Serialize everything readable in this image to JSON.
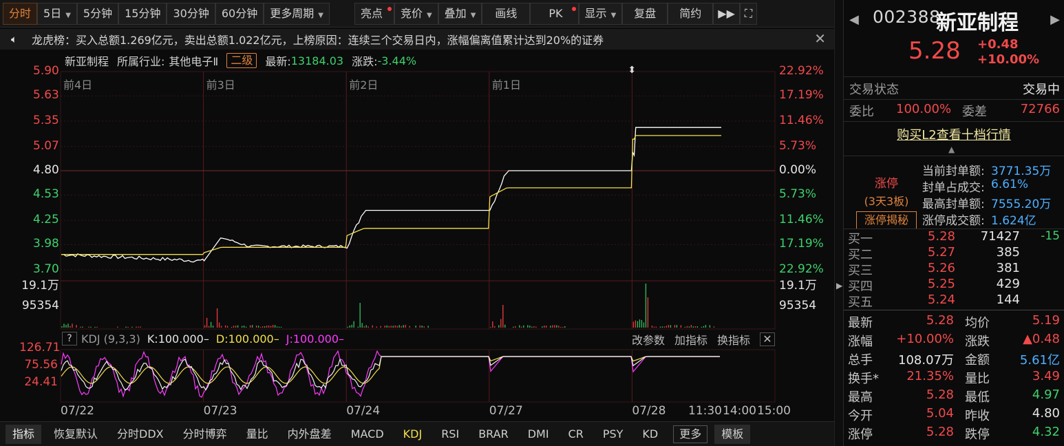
{
  "toolbar": {
    "buttons": [
      {
        "label": "分时"
      },
      {
        "label": "5日"
      },
      {
        "label": "5分钟"
      },
      {
        "label": "15分钟"
      },
      {
        "label": "30分钟"
      },
      {
        "label": "60分钟"
      },
      {
        "label": "更多周期"
      },
      {
        "label": "亮点"
      },
      {
        "label": "竞价"
      },
      {
        "label": "叠加"
      },
      {
        "label": "画线"
      },
      {
        "label": "PK"
      },
      {
        "label": "显示"
      },
      {
        "label": "复盘"
      },
      {
        "label": "简约"
      }
    ]
  },
  "notice": {
    "text": "龙虎榜：买入总额1.269亿元，卖出总额1.022亿元，上榜原因：连续三个交易日内，涨幅偏离值累计达到20%的证券"
  },
  "info": {
    "name": "新亚制程",
    "industry_label": "所属行业:",
    "industry": "其他电子Ⅱ",
    "level": "二级",
    "latest_label": "最新:",
    "latest": "13184.03",
    "change_label": "涨跌:",
    "change": "-3.44%"
  },
  "chart_data": [
    {
      "type": "line",
      "title": "",
      "y_left_ticks": [
        "5.90",
        "5.63",
        "5.35",
        "5.07",
        "4.80",
        "4.53",
        "4.25",
        "3.98",
        "3.70"
      ],
      "y_right_ticks": [
        "22.92%",
        "17.19%",
        "11.46%",
        "5.73%",
        "0.00%",
        "5.73%",
        "11.46%",
        "17.19%",
        "22.92%"
      ],
      "ylim": [
        3.7,
        5.9
      ],
      "prev_close": 4.8,
      "day_labels": [
        "前4日",
        "前3日",
        "前2日",
        "前1日"
      ],
      "x_labels": [
        "07/22",
        "07/23",
        "07/24",
        "07/27",
        "07/28",
        "11:30",
        "14:00",
        "15:00"
      ],
      "series": [
        {
          "name": "price",
          "color": "#ffffff",
          "days": [
            {
              "open": 3.87,
              "close": 3.8,
              "high": 3.9,
              "low": 3.76
            },
            {
              "open": 3.8,
              "close": 3.96,
              "high": 4.06,
              "low": 3.79
            },
            {
              "open": 3.96,
              "close": 4.36,
              "high": 4.36,
              "low": 3.94
            },
            {
              "open": 4.36,
              "close": 4.8,
              "high": 4.8,
              "low": 4.36
            },
            {
              "open": 5.04,
              "close": 5.28,
              "high": 5.28,
              "low": 4.97
            }
          ]
        },
        {
          "name": "avg",
          "color": "#f2e04a",
          "days": [
            3.87,
            3.95,
            4.16,
            4.61,
            5.19
          ]
        }
      ]
    },
    {
      "type": "bar",
      "title": "",
      "y_ticks": [
        "19.1万",
        "95354"
      ],
      "ylim": [
        0,
        191000
      ],
      "note": "intraday volume"
    },
    {
      "type": "line",
      "title": "KDJ (9,3,3)",
      "y_ticks": [
        "126.71",
        "75.56",
        "24.41"
      ],
      "series": [
        {
          "name": "K",
          "value": "100.000",
          "color": "#f0f0f0"
        },
        {
          "name": "D",
          "value": "100.000",
          "color": "#f2e04a"
        },
        {
          "name": "J",
          "value": "100.000",
          "color": "#ff3aff"
        }
      ]
    }
  ],
  "kdj": {
    "help": "?",
    "name": "KDJ (9,3,3)",
    "k": "K:100.000–",
    "d": "D:100.000–",
    "j": "J:100.000–",
    "tools": [
      "改参数",
      "加指标",
      "换指标"
    ]
  },
  "bottom_tabs": [
    "指标",
    "恢复默认",
    "分时DDX",
    "分时博弈",
    "量比",
    "内外盘差",
    "MACD",
    "KDJ",
    "RSI",
    "BRAR",
    "DMI",
    "CR",
    "PSY",
    "KD",
    "更多",
    "模板"
  ],
  "quote": {
    "code": "002388",
    "name": "新亚制程",
    "price": "5.28",
    "change": "+0.48",
    "pct": "+10.00%",
    "status_label": "交易状态",
    "status": "交易中",
    "weibi_label": "委比",
    "weibi": "100.00%",
    "weicha_label": "委差",
    "weicha": "72766",
    "l2_link": "购买L2查看十档行情",
    "limit_label": "涨停",
    "limit_days": "(3天3板)",
    "limit_btn": "涨停揭秘",
    "seal": [
      {
        "label": "当前封单额:",
        "value": "3771.35万"
      },
      {
        "label": "封单占成交:",
        "value": "6.61%"
      },
      {
        "label": "最高封单额:",
        "value": "7555.20万"
      },
      {
        "label": "涨停成交额:",
        "value": "1.624亿"
      }
    ],
    "bids": [
      {
        "label": "买一",
        "price": "5.28",
        "vol": "71427",
        "delta": "-15"
      },
      {
        "label": "买二",
        "price": "5.27",
        "vol": "385",
        "delta": ""
      },
      {
        "label": "买三",
        "price": "5.26",
        "vol": "381",
        "delta": ""
      },
      {
        "label": "买四",
        "price": "5.25",
        "vol": "429",
        "delta": ""
      },
      {
        "label": "买五",
        "price": "5.24",
        "vol": "144",
        "delta": ""
      }
    ],
    "stats": [
      {
        "l1": "最新",
        "v1": "5.28",
        "l2": "均价",
        "v2": "5.19"
      },
      {
        "l1": "涨幅",
        "v1": "+10.00%",
        "l2": "涨跌",
        "v2": "▲0.48"
      },
      {
        "l1": "总手",
        "v1": "108.07万",
        "l2": "金额",
        "v2": "5.61亿"
      },
      {
        "l1": "换手*",
        "v1": "21.35%",
        "l2": "量比",
        "v2": "3.49"
      },
      {
        "l1": "最高",
        "v1": "5.28",
        "l2": "最低",
        "v2": "4.97"
      },
      {
        "l1": "今开",
        "v1": "5.04",
        "l2": "昨收",
        "v2": "4.80"
      },
      {
        "l1": "涨停",
        "v1": "5.28",
        "l2": "跌停",
        "v2": "4.32"
      }
    ]
  }
}
